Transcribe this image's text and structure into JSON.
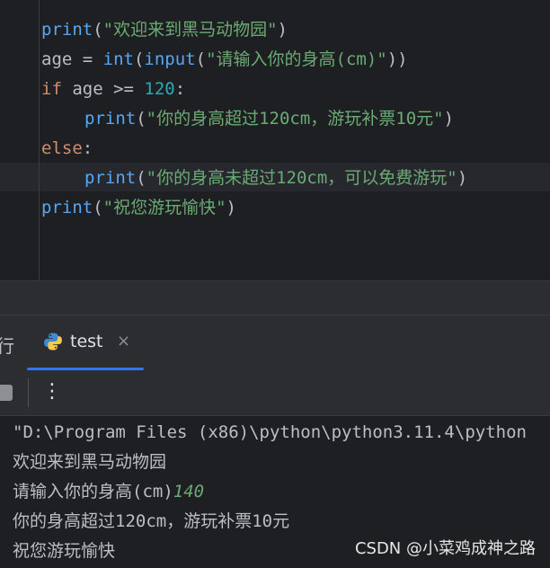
{
  "editor": {
    "line1": {
      "fn": "print",
      "open": "(",
      "str": "\"欢迎来到黑马动物园\"",
      "close": ")"
    },
    "line2": {
      "var": "age = ",
      "fn1": "int",
      "p1": "(",
      "fn2": "input",
      "p2": "(",
      "str": "\"请输入你的身高(cm)\"",
      "close": "))"
    },
    "line3": {
      "kw": "if",
      "mid": " age >= ",
      "num": "120",
      "colon": ":"
    },
    "line4": {
      "fn": "print",
      "open": "(",
      "str": "\"你的身高超过120cm，游玩补票10元\"",
      "close": ")"
    },
    "line5": {
      "kw": "else",
      "colon": ":"
    },
    "line6": {
      "fn": "print",
      "open": "(",
      "str": "\"你的身高未超过120cm，可以免费游玩\"",
      "close": ")"
    },
    "line7": {
      "fn": "print",
      "open": "(",
      "str": "\"祝您游玩愉快\"",
      "close": ")"
    }
  },
  "run_panel": {
    "prev_tab_label": "行",
    "tab_label": "test",
    "close_glyph": "×",
    "more_glyph": "⋮"
  },
  "console": {
    "cmd": "\"D:\\Program Files (x86)\\python\\python3.11.4\\python",
    "out1": "欢迎来到黑马动物园",
    "out2_prompt": "请输入你的身高(cm)",
    "out2_input": "140",
    "out3": "你的身高超过120cm，游玩补票10元",
    "out4": "祝您游玩愉快"
  },
  "watermark": "CSDN @小菜鸡成神之路",
  "colors": {
    "bg": "#1e1f22",
    "panel": "#2b2d30",
    "accent": "#3574f0",
    "string": "#6aab73",
    "function": "#56a8f5",
    "keyword": "#cf8e6d",
    "number": "#2aacb8"
  }
}
